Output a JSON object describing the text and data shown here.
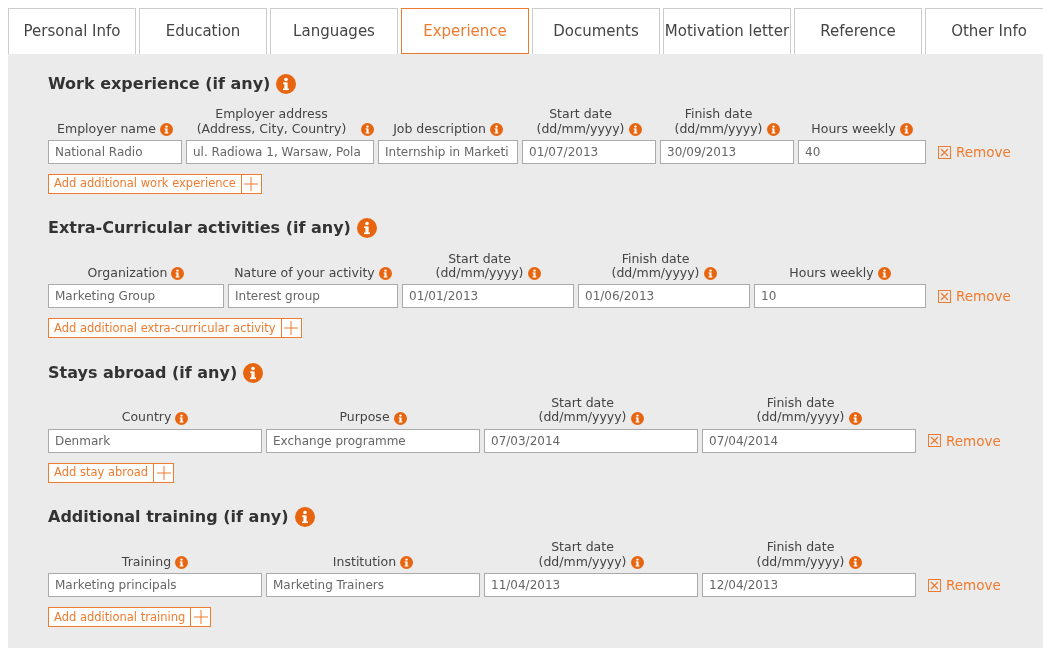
{
  "tabs": [
    {
      "label": "Personal Info",
      "selected": false
    },
    {
      "label": "Education",
      "selected": false
    },
    {
      "label": "Languages",
      "selected": false
    },
    {
      "label": "Experience",
      "selected": true
    },
    {
      "label": "Documents",
      "selected": false
    },
    {
      "label": "Motivation letter",
      "selected": false
    },
    {
      "label": "Reference",
      "selected": false
    },
    {
      "label": "Other Info",
      "selected": false
    }
  ],
  "sections": [
    {
      "title": "Work experience (if any)",
      "columns": [
        "Employer name",
        "Employer address (Address, City, Country)",
        "Job description",
        "Start date\n(dd/mm/yyyy)",
        "Finish date\n(dd/mm/yyyy)",
        "Hours weekly"
      ],
      "values": [
        "National Radio",
        "ul. Radiowa 1, Warsaw, Pola",
        "Internship in Marketi",
        "01/07/2013",
        "30/09/2013",
        "40"
      ],
      "remove_label": "Remove",
      "add_label": "Add additional work experience"
    },
    {
      "title": "Extra-Curricular activities (if any)",
      "columns": [
        "Organization",
        "Nature of your activity",
        "Start date\n(dd/mm/yyyy)",
        "Finish date\n(dd/mm/yyyy)",
        "Hours weekly"
      ],
      "values": [
        "Marketing Group",
        "Interest group",
        "01/01/2013",
        "01/06/2013",
        "10"
      ],
      "remove_label": "Remove",
      "add_label": "Add additional extra-curricular activity"
    },
    {
      "title": "Stays abroad (if any)",
      "columns": [
        "Country",
        "Purpose",
        "Start date\n(dd/mm/yyyy)",
        "Finish date\n(dd/mm/yyyy)"
      ],
      "values": [
        "Denmark",
        "Exchange programme",
        "07/03/2014",
        "07/04/2014"
      ],
      "remove_label": "Remove",
      "add_label": "Add stay abroad"
    },
    {
      "title": "Additional training (if any)",
      "columns": [
        "Training",
        "Institution",
        "Start date\n(dd/mm/yyyy)",
        "Finish date\n(dd/mm/yyyy)"
      ],
      "values": [
        "Marketing principals",
        "Marketing Trainers",
        "11/04/2013",
        "12/04/2013"
      ],
      "remove_label": "Remove",
      "add_label": "Add additional training"
    }
  ]
}
